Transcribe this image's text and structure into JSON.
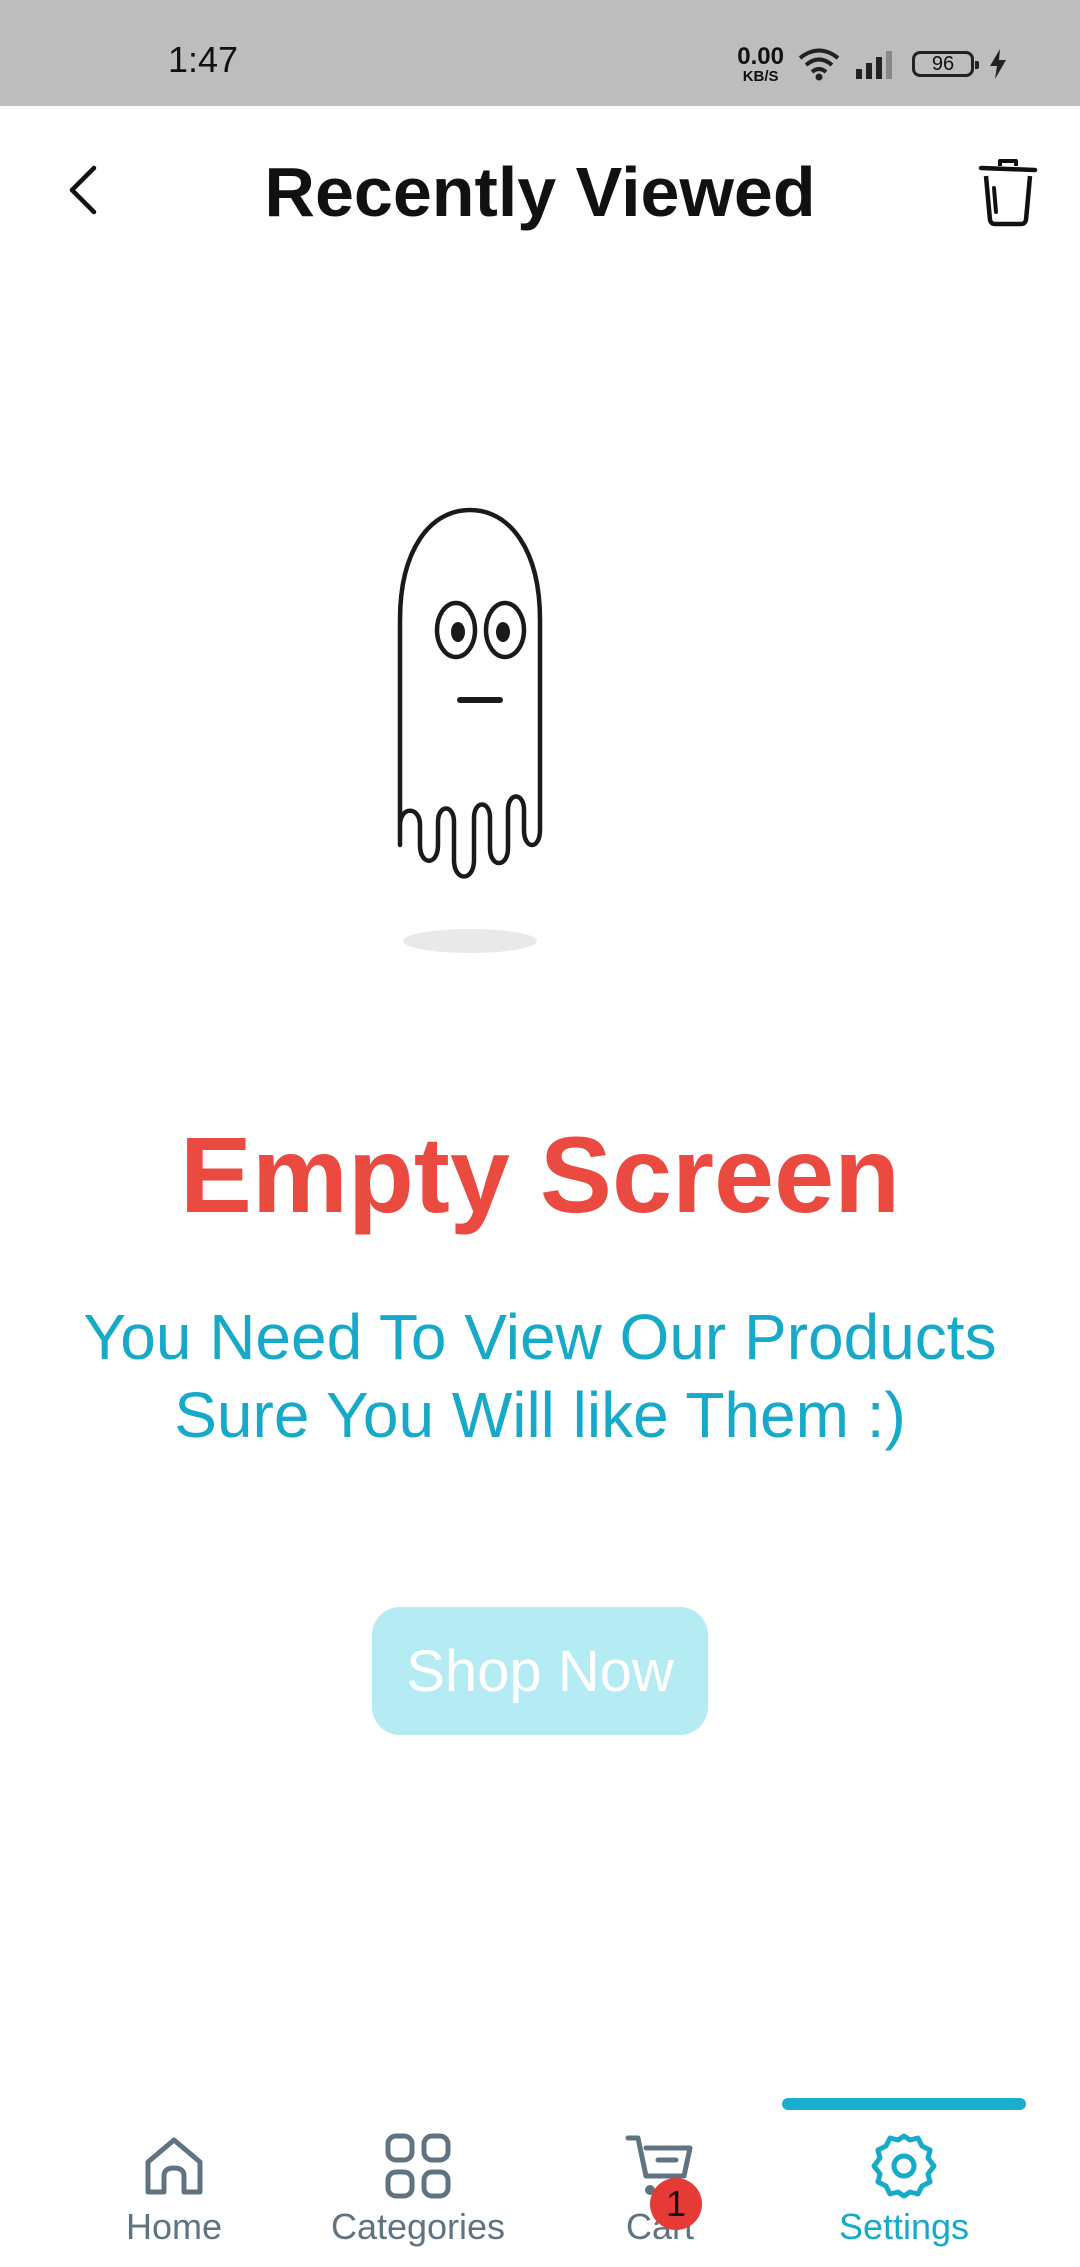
{
  "status_bar": {
    "time": "1:47",
    "net_speed_value": "0.00",
    "net_speed_unit": "KB/S",
    "battery_level": "96"
  },
  "header": {
    "title": "Recently Viewed",
    "back_icon": "chevron-left-icon",
    "delete_icon": "trash-icon"
  },
  "empty_state": {
    "illustration": "ghost-icon",
    "title": "Empty Screen",
    "subtitle_line1": "You Need To View Our Products",
    "subtitle_line2": "Sure You Will like Them :)",
    "button_label": "Shop Now"
  },
  "bottom_nav": {
    "items": [
      {
        "label": "Home",
        "icon": "home-icon"
      },
      {
        "label": "Categories",
        "icon": "grid-icon"
      },
      {
        "label": "Cart",
        "icon": "cart-icon",
        "badge": "1"
      },
      {
        "label": "Settings",
        "icon": "gear-icon",
        "active": true
      }
    ]
  },
  "colors": {
    "accent": "#16a9c8",
    "empty_title": "#ea4a3f",
    "button_bg": "#b5ebf2",
    "badge": "#e53a35"
  }
}
